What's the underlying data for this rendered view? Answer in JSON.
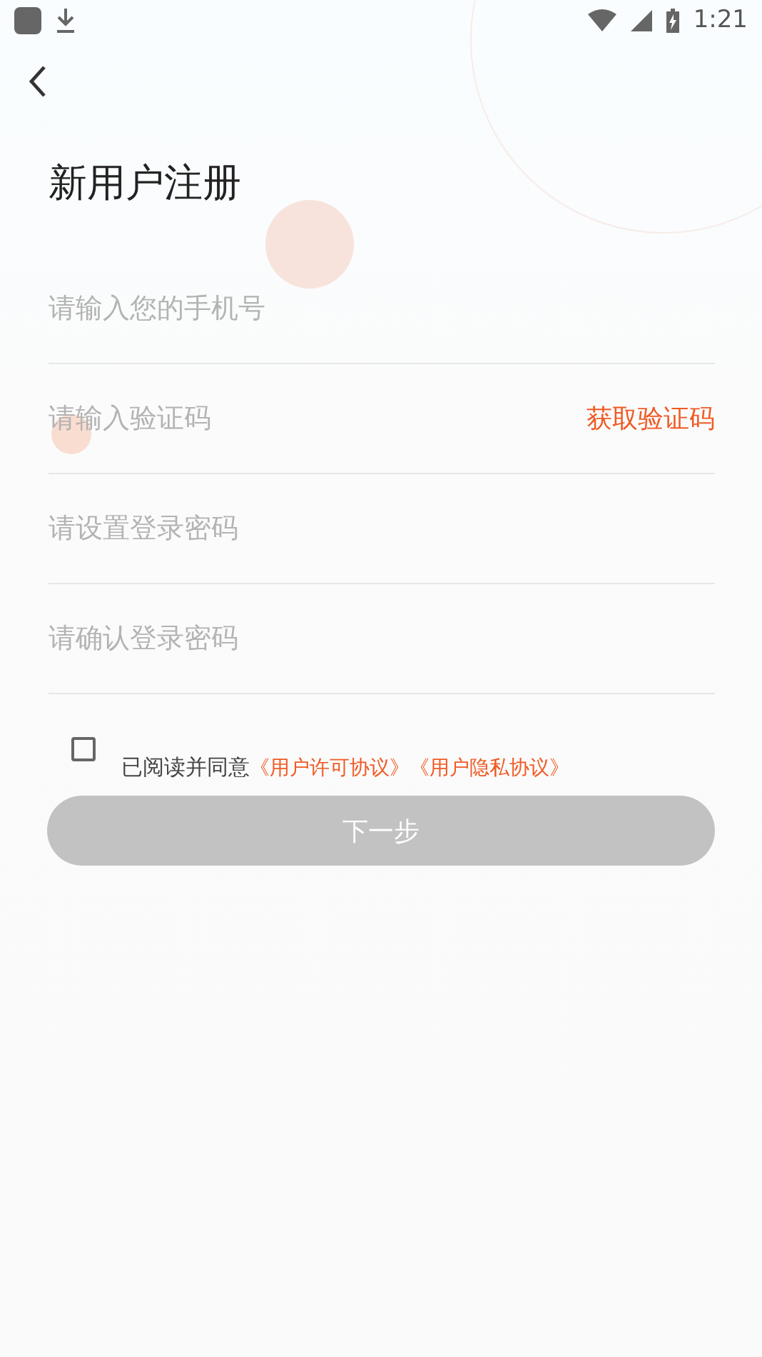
{
  "status_bar": {
    "time": "1:21"
  },
  "title": "新用户注册",
  "fields": [
    {
      "placeholder": "请输入您的手机号"
    },
    {
      "placeholder": "请输入验证码",
      "action": "获取验证码"
    },
    {
      "placeholder": "请设置登录密码"
    },
    {
      "placeholder": "请确认登录密码"
    }
  ],
  "agreement": {
    "checked": false,
    "text": "已阅读并同意",
    "links": [
      "《用户许可协议》",
      "《用户隐私协议》"
    ]
  },
  "next_button": {
    "label": "下一步",
    "disabled": true
  }
}
